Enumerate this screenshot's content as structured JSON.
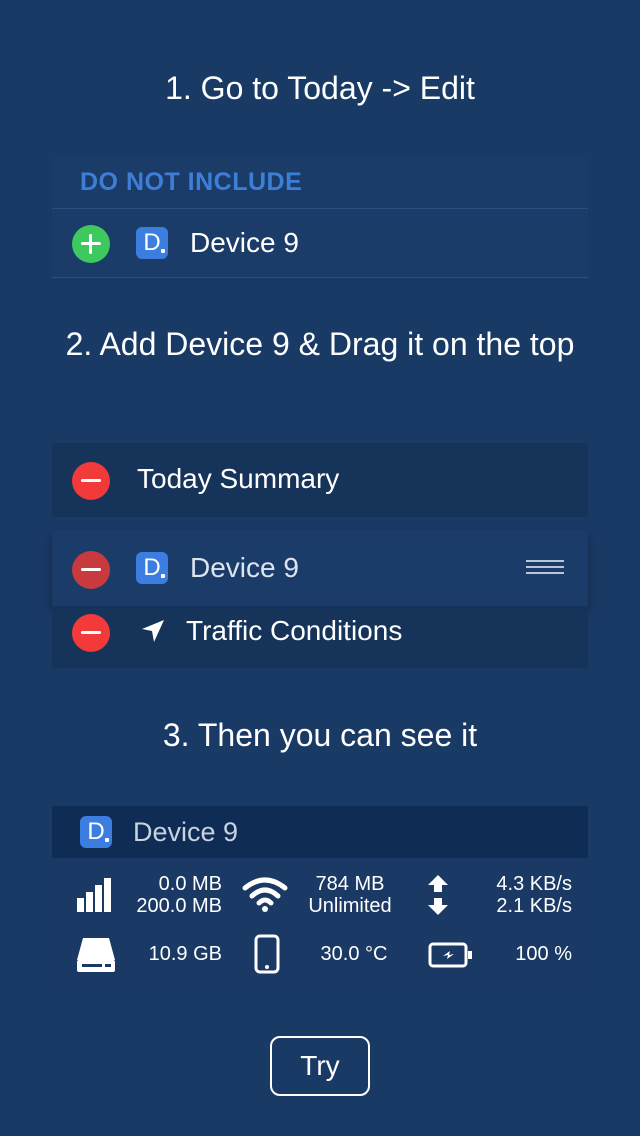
{
  "steps": {
    "step1": "1. Go to Today -> Edit",
    "step2": "2. Add Device 9 & Drag it on the top",
    "step3": "3. Then you can see it"
  },
  "edit_list": {
    "section_header": "DO NOT INCLUDE",
    "add_row_label": "Device 9"
  },
  "reorder_list": {
    "rows": [
      {
        "label": "Today Summary"
      },
      {
        "label": "Device 9",
        "icon": "app-icon-d"
      },
      {
        "label": "Traffic Conditions",
        "icon": "location-arrow-icon"
      }
    ]
  },
  "widget": {
    "app_icon_letter": "D",
    "title": "Device 9",
    "cellular_used": "0.0 MB",
    "cellular_limit": "200.0 MB",
    "wifi_used": "784 MB",
    "wifi_limit": "Unlimited",
    "upload_speed": "4.3 KB/s",
    "download_speed": "2.1 KB/s",
    "storage": "10.9 GB",
    "temperature": "30.0 °C",
    "battery": "100 %"
  },
  "try_label": "Try",
  "colors": {
    "background": "#1a3a66",
    "add_green": "#3dc95e",
    "delete_red": "#f23a3a",
    "header_blue": "#3d7fd6",
    "app_icon_blue": "#3b7ee0"
  }
}
